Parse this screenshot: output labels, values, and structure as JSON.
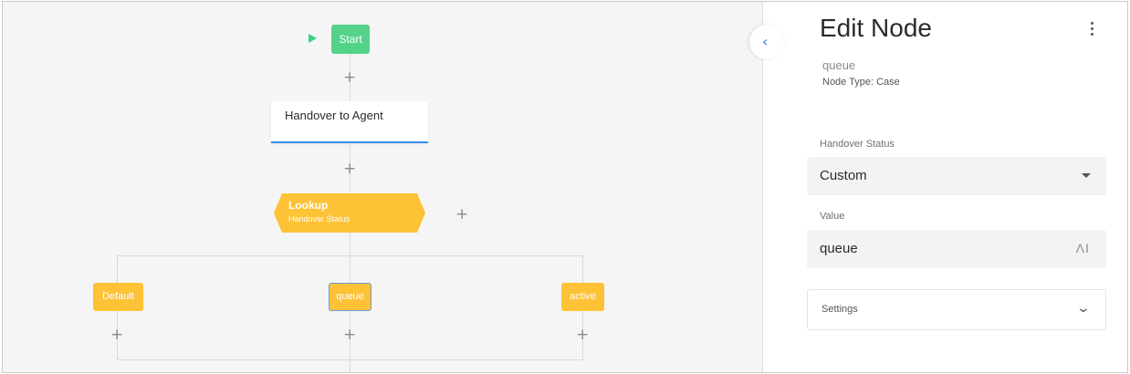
{
  "canvas": {
    "start_label": "Start",
    "handover_label": "Handover to Agent",
    "lookup_title": "Lookup",
    "lookup_subtitle": "Handover Status",
    "cases": [
      "Default",
      "queue",
      "active"
    ],
    "add_symbol": "+",
    "colors": {
      "start": "#54d28a",
      "case": "#fdc235",
      "accent": "#3c8ee8"
    }
  },
  "panel": {
    "collapse_symbol": "‹",
    "title": "Edit Node",
    "node_name": "queue",
    "node_type": "Node Type: Case",
    "handover_status_label": "Handover Status",
    "handover_status_value": "Custom",
    "value_label": "Value",
    "value_value": "queue",
    "ai_symbol": "ΛI",
    "settings_label": "Settings",
    "chevron_symbol": "⌄"
  }
}
